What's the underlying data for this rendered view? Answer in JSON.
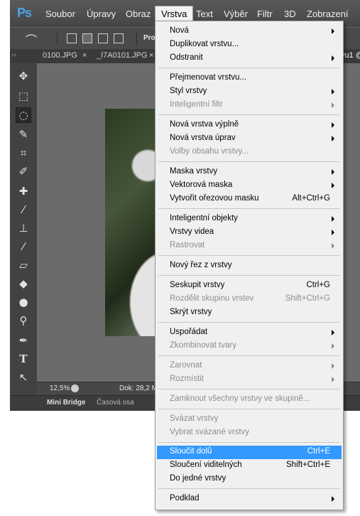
{
  "app": {
    "logo": "Ps"
  },
  "menubar": {
    "soubor": "Soubor",
    "upravy": "Úpravy",
    "obraz": "Obraz",
    "vrstva": "Vrstva",
    "text": "Text",
    "vyber": "Výběr",
    "filtr": "Filtr",
    "three_d": "3D",
    "zobrazeni": "Zobrazení"
  },
  "options_bar": {
    "text": "Pro"
  },
  "tabs": {
    "tab1": "0100.JPG",
    "tab1_close": "×",
    "tab2": "_I7A0101.JPG",
    "tab2_close": "×",
    "tab3": "vu1 @"
  },
  "status": {
    "zoom": "12,5%",
    "doc": "Dok: 28,2 M"
  },
  "bottom_tabs": {
    "mini_bridge": "Mini Bridge",
    "timeline": "Časová osa"
  },
  "menu": {
    "nova": "Nová",
    "duplikovat": "Duplikovat vrstvu...",
    "odstranit": "Odstranit",
    "prejmenovat": "Přejmenovat vrstvu...",
    "styl": "Styl vrstvy",
    "inteligentni_filtr": "Inteligentní filtr",
    "nova_vyplne": "Nová vrstva výplně",
    "nova_uprav": "Nová vrstva úprav",
    "volby_obsahu": "Volby obsahu vrstvy...",
    "maska_vrstvy": "Maska vrstvy",
    "vektorova_maska": "Vektorová maska",
    "orezova_maska": "Vytvořit ořezovou masku",
    "orezova_maska_sc": "Alt+Ctrl+G",
    "inteligentni_objekty": "Inteligentní objekty",
    "vrstvy_videa": "Vrstvy videa",
    "rastrovat": "Rastrovat",
    "novy_rez": "Nový řez z vrstvy",
    "seskupit": "Seskupit vrstvy",
    "seskupit_sc": "Ctrl+G",
    "rozdelit": "Rozdělit skupinu vrstev",
    "rozdelit_sc": "Shift+Ctrl+G",
    "skryt": "Skrýt vrstvy",
    "usporadat": "Uspořádat",
    "zkombinovat": "Zkombinovat tvary",
    "zarovnat": "Zarovnat",
    "rozmistit": "Rozmístit",
    "zamknout": "Zamknout všechny vrstvy ve skupině...",
    "svazat": "Svázat vrstvy",
    "vybrat_svazane": "Vybrat svázané vrstvy",
    "sloucit_dolu": "Sloučit dolů",
    "sloucit_dolu_sc": "Ctrl+E",
    "sloucit_viditelnych": "Sloučení viditelných",
    "sloucit_viditelnych_sc": "Shift+Ctrl+E",
    "do_jedne": "Do jedné vrstvy",
    "podklad": "Podklad"
  }
}
